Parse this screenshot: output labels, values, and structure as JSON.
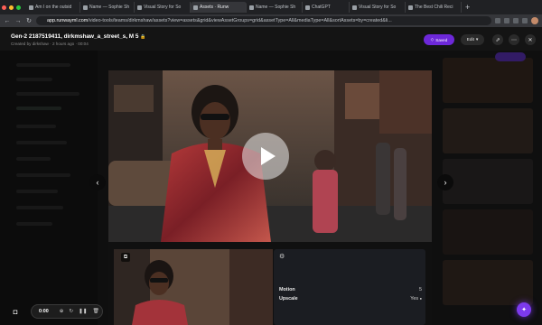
{
  "browser": {
    "tabs": [
      {
        "label": "Am I on the outsid"
      },
      {
        "label": "Name — Sophie Sh"
      },
      {
        "label": "Visual Story for So"
      },
      {
        "label": "Assets · Runw"
      },
      {
        "label": "Name — Sophie Sh"
      },
      {
        "label": "ChatGPT"
      },
      {
        "label": "Visual Story for So"
      },
      {
        "label": "The Best Chili Reci"
      }
    ],
    "new_tab": "+",
    "url_host": "app.runwayml.com",
    "url_path": "/video-tools/teams/dirkmshaw/assets?view=assets&grid&viewAssetGroups=grid&assetType=All&mediaType=All&sortAssets=by=created&li..."
  },
  "header": {
    "asset_title": "Gen-2 2187519411, dirkmshaw_a_street_s, M 5",
    "lock_icon": "🔒",
    "asset_meta": "Created by dirkshaw · 2 hours ago · 00:04",
    "primary_button": "Saved",
    "edit_button": "Edit",
    "edit_chevron": "▾",
    "share_icon": "⇗",
    "more_icon": "⋯",
    "close_icon": "✕"
  },
  "viewer": {
    "prev_icon": "‹",
    "next_icon": "›",
    "thumb_icon": "⧉",
    "settings_icon": "⚙",
    "settings": [
      {
        "key": "Motion",
        "value": "5"
      },
      {
        "key": "Upscale",
        "value": "Yes"
      }
    ]
  },
  "player": {
    "camera_icon": "◘",
    "time": "0:00",
    "controls": [
      "⊕",
      "↻",
      "❚❚",
      "🗑"
    ]
  },
  "help_icon": "✦",
  "colors": {
    "accent": "#6d28d9",
    "chrome_dark": "#202124"
  }
}
